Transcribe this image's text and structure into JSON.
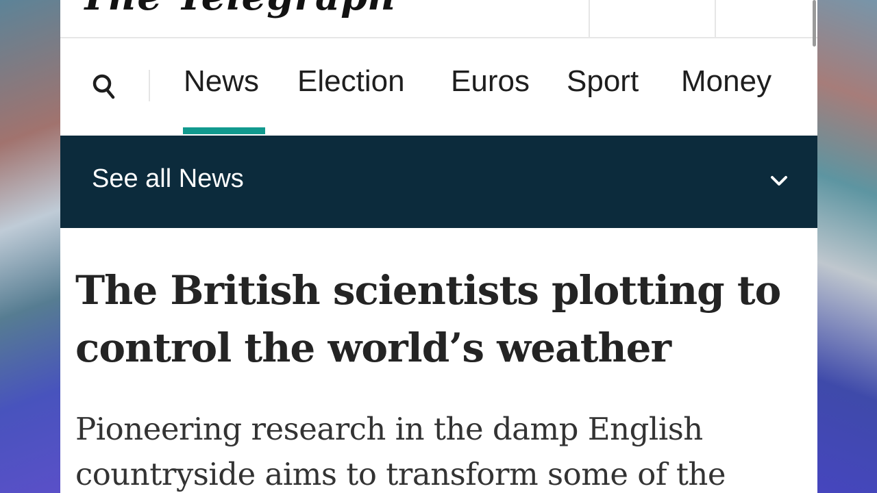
{
  "masthead": {
    "logo_text": "The Telegraph"
  },
  "nav": {
    "search_icon": "search-icon",
    "tabs": [
      {
        "label": "News",
        "active": true
      },
      {
        "label": "Election",
        "active": false
      },
      {
        "label": "Euros",
        "active": false
      },
      {
        "label": "Sport",
        "active": false
      },
      {
        "label": "Money",
        "active": false
      }
    ],
    "accent_color": "#11998e"
  },
  "subnav": {
    "label": "See all News",
    "icon": "chevron-down-icon",
    "background_color": "#0c2b3c"
  },
  "article": {
    "headline": "The British scientists plotting to control the world’s weather",
    "standfirst": "Pioneering research in the damp English countryside aims to transform some of the"
  }
}
